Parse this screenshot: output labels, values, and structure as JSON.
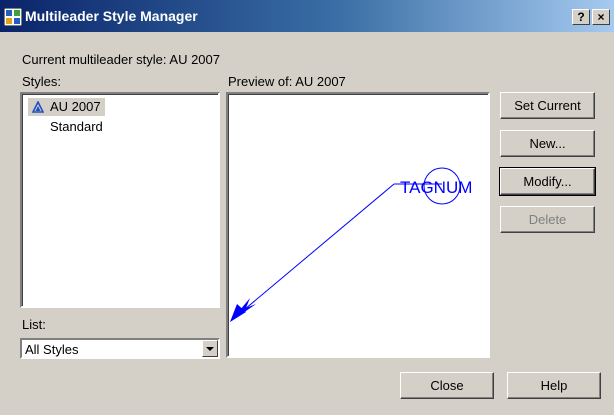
{
  "window": {
    "title": "Multileader Style Manager",
    "help_btn": "?",
    "close_btn": "×"
  },
  "current_style_label": "Current multileader style: AU 2007",
  "styles_label": "Styles:",
  "styles": [
    {
      "label": "AU 2007",
      "selected": true,
      "icon": "annotative-triangle-icon"
    },
    {
      "label": "Standard",
      "selected": false
    }
  ],
  "preview_label": "Preview of: AU 2007",
  "preview": {
    "tag_text": "TAGNUM",
    "leader_color": "#0000ff"
  },
  "list_label": "List:",
  "list_value": "All Styles",
  "buttons": {
    "set_current": "Set Current",
    "new": "New...",
    "modify": "Modify...",
    "delete": "Delete",
    "close": "Close",
    "help": "Help"
  },
  "colors": {
    "titlebar_start": "#0a246a",
    "titlebar_end": "#a6caf0",
    "face": "#d4d0c8"
  }
}
